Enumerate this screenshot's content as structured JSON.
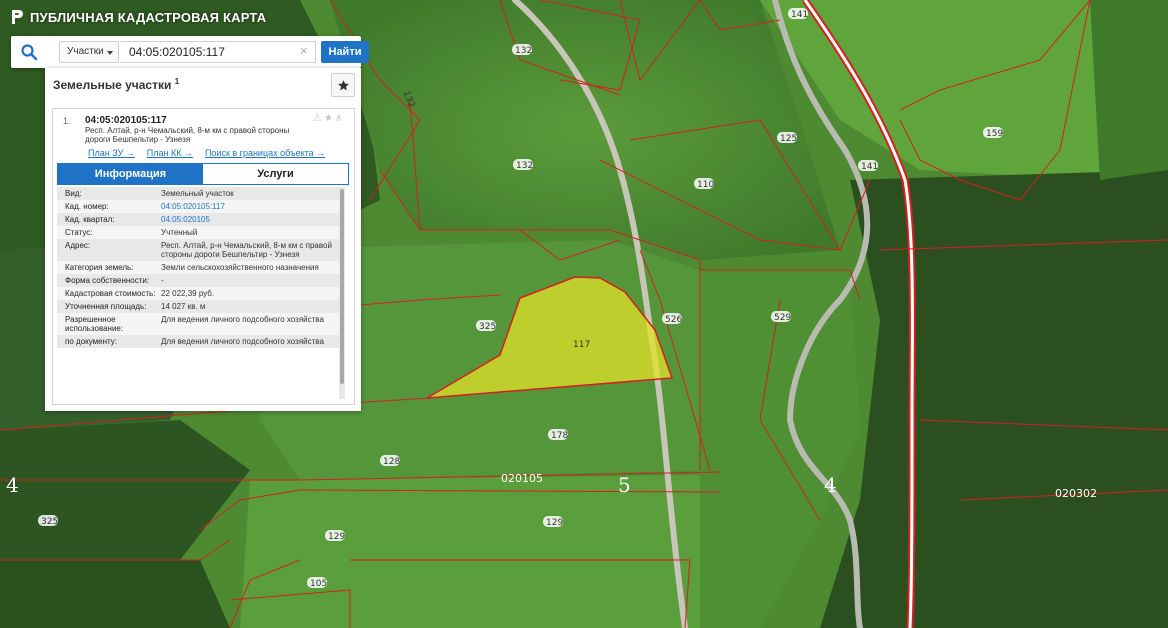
{
  "app": {
    "title": "ПУБЛИЧНАЯ КАДАСТРОВАЯ КАРТА",
    "logo_icon": "rosreestr-logo-icon"
  },
  "search": {
    "type_label": "Участки",
    "query": "04:05:020105:117",
    "button_label": "Найти",
    "clear_symbol": "×"
  },
  "panel": {
    "title": "Земельные участки",
    "count": "1",
    "star_symbol": "★",
    "result": {
      "index": "1.",
      "cadastral_number": "04:05:020105:117",
      "address": "Респ. Алтай, р-н Чемальский, 8-м км с правой стороны дороги Бешпельтир - Узнезя",
      "links": [
        "План ЗУ →",
        "План КК →",
        "Поиск в границах объекта →"
      ],
      "tabs": [
        "Информация",
        "Услуги"
      ],
      "active_tab": "Информация",
      "info": [
        {
          "key": "Вид:",
          "value": "Земельный участок"
        },
        {
          "key": "Кад. номер:",
          "value": "04:05:020105:117",
          "link": true
        },
        {
          "key": "Кад. квартал:",
          "value": "04:05:020105",
          "link": true
        },
        {
          "key": "Статус:",
          "value": "Учтенный"
        },
        {
          "key": "Адрес:",
          "value": "Респ. Алтай, р-н Чемальский, 8-м км с правой стороны дороги Бешпельтир - Узнезя"
        },
        {
          "key": "Категория земель:",
          "value": "Земли сельскохозяйственного назначения"
        },
        {
          "key": "Форма собственности:",
          "value": "-"
        },
        {
          "key": "Кадастровая стоимость:",
          "value": "22 022,39 руб."
        },
        {
          "key": "Уточненная площадь:",
          "value": "14 027 кв. м"
        },
        {
          "key": "Разрешенное использование:",
          "value": "Для ведения личного подсобного хозяйства"
        },
        {
          "key": "по документу:",
          "value": "Для ведения личного подсобного хозяйства"
        }
      ]
    }
  },
  "map": {
    "highlight_color": "#e2e22a",
    "boundary_color": "#d42020",
    "selected_parcel": "117",
    "parcel_labels": [
      "132",
      "132",
      "132",
      "141",
      "141",
      "125",
      "110",
      "159",
      "325",
      "325",
      "526",
      "529",
      "178",
      "128",
      "129",
      "129",
      "105"
    ],
    "quarter_labels": [
      "020105",
      "020302"
    ],
    "zone_labels": [
      "4",
      "4",
      "5"
    ]
  }
}
